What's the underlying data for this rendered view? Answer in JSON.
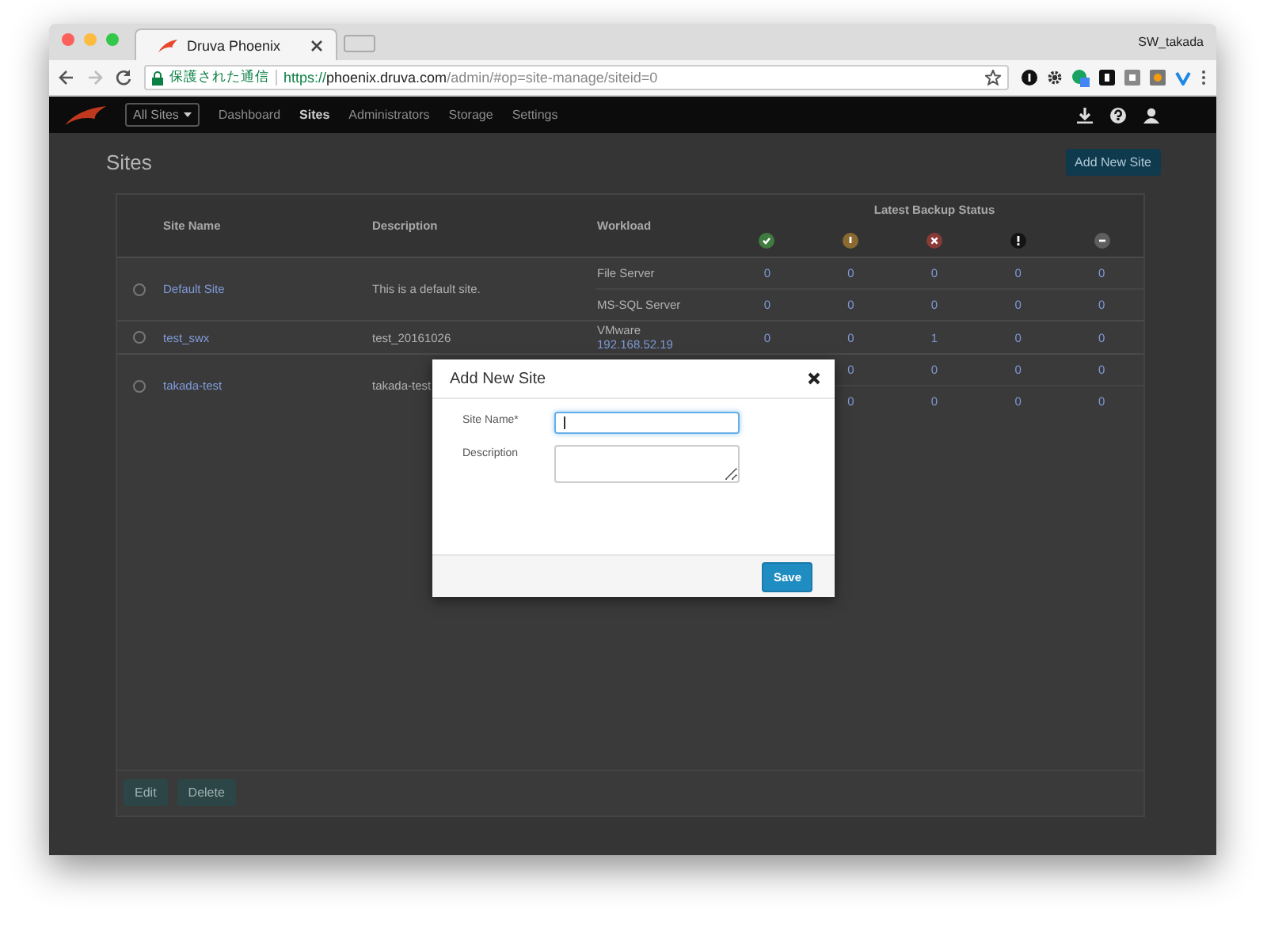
{
  "browser": {
    "tab_title": "Druva Phoenix",
    "profile": "SW_takada",
    "security_label": "保護された通信",
    "url_scheme": "https://",
    "url_host": "phoenix.druva.com",
    "url_path": "/admin/#op=site-manage/siteid=0"
  },
  "navbar": {
    "site_selector": "All Sites",
    "items": [
      {
        "label": "Dashboard",
        "selected": false
      },
      {
        "label": "Sites",
        "selected": true
      },
      {
        "label": "Administrators",
        "selected": false
      },
      {
        "label": "Storage",
        "selected": false
      },
      {
        "label": "Settings",
        "selected": false
      }
    ]
  },
  "page": {
    "title": "Sites",
    "add_button": "Add New Site"
  },
  "table": {
    "columns": [
      "Site Name",
      "Description",
      "Workload"
    ],
    "status_group": "Latest Backup Status",
    "status_columns": [
      {
        "kind": "ok",
        "color": "#3f7a3f"
      },
      {
        "kind": "warning",
        "color": "#8a6a30"
      },
      {
        "kind": "error",
        "color": "#8a3a36"
      },
      {
        "kind": "info",
        "color": "#141414"
      },
      {
        "kind": "unknown",
        "color": "#5e5e5e"
      }
    ],
    "rows": [
      {
        "name": "Default Site",
        "description": "This is a default site.",
        "selected": false,
        "workloads": [
          {
            "name": "File Server",
            "counts": [
              "0",
              "0",
              "0",
              "0",
              "0"
            ]
          },
          {
            "name": "MS-SQL Server",
            "counts": [
              "0",
              "0",
              "0",
              "0",
              "0"
            ]
          }
        ]
      },
      {
        "name": "test_swx",
        "description": "test_20161026",
        "selected": false,
        "workloads": [
          {
            "name": "VMware",
            "host": "192.168.52.19",
            "counts": [
              "0",
              "0",
              "1",
              "0",
              "0"
            ]
          }
        ]
      },
      {
        "name": "takada-test",
        "description": "takada-test",
        "selected": false,
        "workloads": [
          {
            "counts": [
              "0",
              "0",
              "0",
              "0"
            ]
          },
          {
            "counts": [
              "0",
              "0",
              "0",
              "0"
            ]
          }
        ]
      }
    ]
  },
  "footer_buttons": [
    {
      "label": "Edit",
      "disabled": true
    },
    {
      "label": "Delete",
      "disabled": true
    }
  ],
  "modal": {
    "title": "Add New Site",
    "fields": [
      {
        "kind": "text",
        "label": "Site Name*",
        "focused": true
      },
      {
        "kind": "textarea",
        "label": "Description",
        "focused": false
      }
    ],
    "save_button": "Save"
  }
}
